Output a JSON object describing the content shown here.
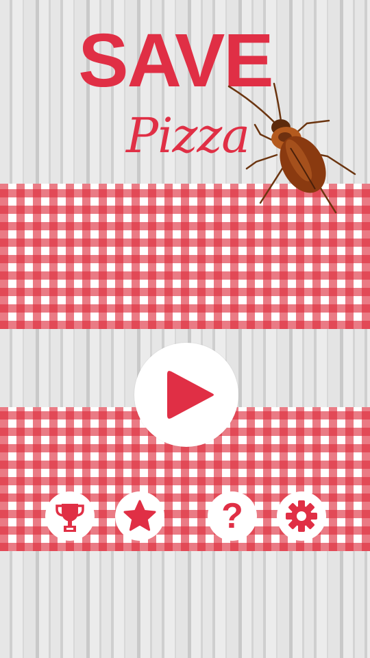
{
  "title": {
    "main": "SAVE",
    "sub": "Pizza"
  },
  "buttons": {
    "play": "play-icon",
    "leaderboard": "trophy-icon",
    "rate": "star-icon",
    "help": "?",
    "settings": "gear-icon"
  },
  "colors": {
    "accent": "#e02f45",
    "cloth_red": "#dd2a3a",
    "background": "#e2e2e2",
    "button_bg": "#ffffff",
    "cockroach": "#8a3a10"
  }
}
